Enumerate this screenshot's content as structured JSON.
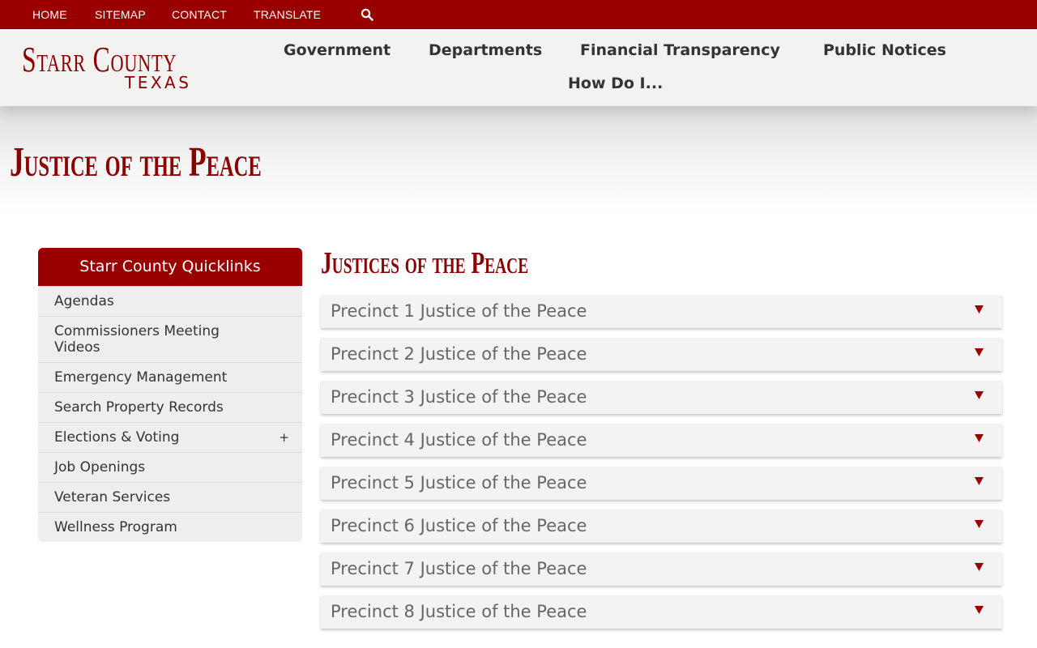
{
  "topnav": {
    "home": "HOME",
    "sitemap": "SITEMAP",
    "contact": "CONTACT",
    "translate": "TRANSLATE",
    "search_icon": "search-icon"
  },
  "logo": {
    "line1": "Starr County",
    "line2": "TEXAS"
  },
  "mainnav": {
    "government": "Government",
    "departments": "Departments",
    "financial": "Financial Transparency",
    "notices": "Public Notices",
    "howdoi": "How Do I..."
  },
  "page_title": "Justice of the Peace",
  "sidebar": {
    "title": "Starr County Quicklinks",
    "items": [
      {
        "label": "Agendas"
      },
      {
        "label": "Commissioners Meeting Videos"
      },
      {
        "label": "Emergency Management"
      },
      {
        "label": "Search Property Records"
      },
      {
        "label": "Elections & Voting",
        "expand": "+"
      },
      {
        "label": "Job Openings"
      },
      {
        "label": "Veteran Services"
      },
      {
        "label": "Wellness Program"
      }
    ]
  },
  "section_title": "Justices of the Peace",
  "accordion": [
    {
      "label": "Precinct 1 Justice of the Peace"
    },
    {
      "label": "Precinct 2 Justice of the Peace"
    },
    {
      "label": "Precinct 3 Justice of the Peace"
    },
    {
      "label": "Precinct 4 Justice of the Peace"
    },
    {
      "label": "Precinct 5 Justice of the Peace"
    },
    {
      "label": "Precinct 6 Justice of the Peace"
    },
    {
      "label": "Precinct 7 Justice of the Peace"
    },
    {
      "label": "Precinct 8 Justice of the Peace"
    }
  ],
  "colors": {
    "brand": "#990000",
    "title": "#8b0000",
    "text": "#333333",
    "panel": "#f3f3f3"
  }
}
